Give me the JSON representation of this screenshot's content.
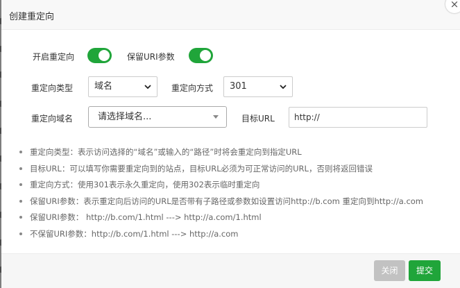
{
  "modal": {
    "title": "创建重定向",
    "close_icon": "×"
  },
  "form": {
    "enable_label": "开启重定向",
    "enable_on": true,
    "keep_uri_label": "保留URI参数",
    "keep_uri_on": true,
    "type_label": "重定向类型",
    "type_value": "域名",
    "method_label": "重定向方式",
    "method_value": "301",
    "domain_label": "重定向域名",
    "domain_placeholder": "请选择域名...",
    "target_label": "目标URL",
    "target_value": "http://"
  },
  "notes": [
    "重定向类型：表示访问选择的“域名”或输入的“路径”时将会重定向到指定URL",
    "目标URL：可以填写你需要重定向到的站点，目标URL必须为可正常访问的URL，否则将返回错误",
    "重定向方式：使用301表示永久重定向，使用302表示临时重定向",
    "保留URI参数：表示重定向后访问的URL是否带有子路径或参数如设置访问http://b.com 重定向到http://a.com",
    "保留URI参数：  http://b.com/1.html ---> http://a.com/1.html",
    "不保留URI参数：http://b.com/1.html ---> http://a.com"
  ],
  "footer": {
    "close_label": "关闭",
    "submit_label": "提交"
  },
  "colors": {
    "accent": "#20a53a",
    "disabled": "#c2c2c2"
  }
}
